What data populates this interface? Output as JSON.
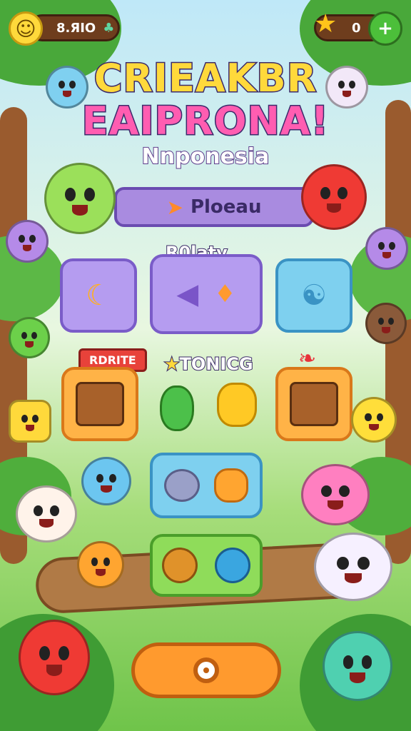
{
  "header": {
    "left_counter": "8.ЯIO",
    "right_counter": "0"
  },
  "title": {
    "line1": "CRIEAKBR",
    "line2": "EAIPRONA!",
    "subtitle": "Nnponesia"
  },
  "banner": {
    "label": "Ploeau"
  },
  "sections": {
    "section1_label": "R0laty",
    "section2_label": "TONICG",
    "ribbon_label": "RDRITE"
  },
  "colors": {
    "accent_orange": "#ff9a2e",
    "purple": "#b59cf0",
    "blue": "#7ed0ef",
    "green": "#8fdc5a"
  },
  "icons": {
    "cta": "target-icon",
    "top_left": "smiley-icon",
    "top_right": "plus-icon",
    "star": "star-icon"
  }
}
